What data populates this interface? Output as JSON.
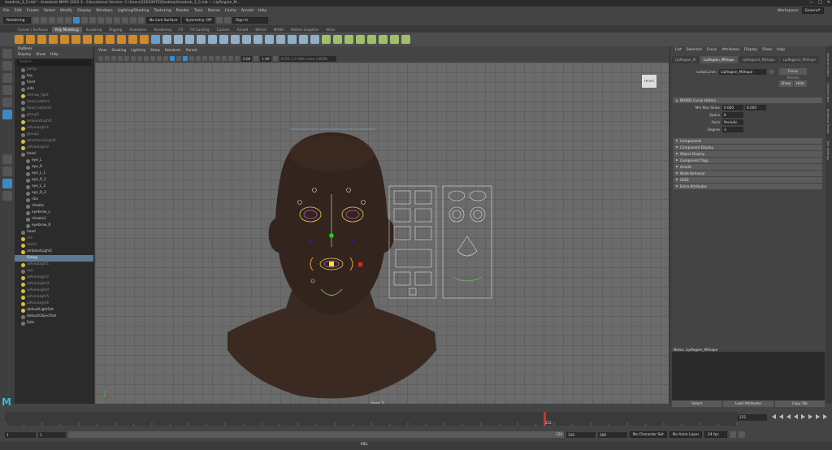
{
  "window": {
    "title": "headrek_3_5.mb* - Autodesk MAYA 2022.3 - Educational Version: C:\\Users\\2201997E\\Desktop\\headrek_3_5.mb  ---  LipRegion_M..."
  },
  "menubar": [
    "File",
    "Edit",
    "Create",
    "Select",
    "Modify",
    "Display",
    "Windows",
    "Lighting/Shading",
    "Texturing",
    "Render",
    "Toon",
    "Stereo",
    "Cache",
    "Arnold",
    "Help"
  ],
  "workspace": {
    "label": "Workspace:",
    "value": "General*"
  },
  "statusline": {
    "mode": "Rendering",
    "live_surface": "No Live Surface",
    "symmetry": "Symmetry: Off",
    "sign_in": "Sign In"
  },
  "shelf_tabs": [
    "Curves / Surfaces",
    "Poly Modeling",
    "Sculpting",
    "Rigging",
    "Animation",
    "Rendering",
    "FX",
    "FX Caching",
    "Custom",
    "Arnold",
    "Bifrost",
    "MASH",
    "Motion Graphics",
    "XGen"
  ],
  "shelf_active": "Poly Modeling",
  "outliner": {
    "title": "Outliner",
    "menu": [
      "Display",
      "Show",
      "Help"
    ],
    "search_placeholder": "Search...",
    "rows": [
      {
        "label": "persp",
        "state": "dim"
      },
      {
        "label": "top",
        "state": ""
      },
      {
        "label": "front",
        "state": ""
      },
      {
        "label": "side",
        "state": ""
      },
      {
        "label": "arlmap_light",
        "state": "dim"
      },
      {
        "label": "head_bottom",
        "state": "dim"
      },
      {
        "label": "head_bottom1",
        "state": "dim"
      },
      {
        "label": "group1",
        "state": "dim"
      },
      {
        "label": "ambientLight1",
        "state": "dim"
      },
      {
        "label": "aiAreaLight1",
        "state": "dim"
      },
      {
        "label": "group2",
        "state": "dim"
      },
      {
        "label": "directionalLight1",
        "state": "dim"
      },
      {
        "label": "aiAreaLight2",
        "state": "dim"
      },
      {
        "label": "head",
        "state": ""
      },
      {
        "label": "eye_L",
        "state": ""
      },
      {
        "label": "eye_R",
        "state": ""
      },
      {
        "label": "eye_L_1",
        "state": ""
      },
      {
        "label": "eye_R_1",
        "state": ""
      },
      {
        "label": "eye_L_2",
        "state": ""
      },
      {
        "label": "eye_R_2",
        "state": ""
      },
      {
        "label": "ribs",
        "state": ""
      },
      {
        "label": "cheeks",
        "state": ""
      },
      {
        "label": "eyebrow_L",
        "state": ""
      },
      {
        "label": "cheeks1",
        "state": ""
      },
      {
        "label": "eyebrow_R",
        "state": ""
      },
      {
        "label": "head",
        "state": ""
      },
      {
        "label": "rim",
        "state": "dim"
      },
      {
        "label": "area1",
        "state": "dim"
      },
      {
        "label": "ambientLight1",
        "state": ""
      },
      {
        "label": "Group",
        "state": "sel"
      },
      {
        "label": "aiAreaLight1",
        "state": "dim"
      },
      {
        "label": "eye",
        "state": "dim"
      },
      {
        "label": "aiAreaLight2",
        "state": "dim"
      },
      {
        "label": "aiAreaLight3",
        "state": "dim"
      },
      {
        "label": "aiAreaLight4",
        "state": "dim"
      },
      {
        "label": "aiAreaLight5",
        "state": "dim"
      },
      {
        "label": "aiAreaLight6",
        "state": "dim"
      },
      {
        "label": "defaultLightSet",
        "state": ""
      },
      {
        "label": "defaultObjectSet",
        "state": ""
      },
      {
        "label": "Eats",
        "state": ""
      }
    ]
  },
  "viewport": {
    "menu": [
      "View",
      "Shading",
      "Lighting",
      "Show",
      "Renderer",
      "Panels"
    ],
    "value_a": "0.00",
    "value_b": "1.00",
    "color_space": "ACES 1.0 SDR-video (sRGB)",
    "camera_button": "FRONT",
    "camera_label": "front_2"
  },
  "attribute_editor": {
    "menu": [
      "List",
      "Selected",
      "Focus",
      "Attributes",
      "Display",
      "Show",
      "Help"
    ],
    "tabs": [
      "LipRegion_M",
      "LipRegion_MShape",
      "LipRegion1_MShape",
      "LipRegion2_MShape"
    ],
    "active_tab": "LipRegion_MShape",
    "node_label": "nurbsCurve:",
    "node_value": "LipRegion_MShape",
    "focus": "Focus",
    "presets": "Presets",
    "show": "Show",
    "hide": "Hide",
    "section_open": "NURBS Curve History",
    "fields": [
      {
        "label": "Min Max Value",
        "values": [
          "0.000",
          "8.000"
        ]
      },
      {
        "label": "Spans",
        "values": [
          "8"
        ]
      },
      {
        "label": "Form",
        "values": [
          "Periodic"
        ]
      },
      {
        "label": "Degree",
        "values": [
          "3"
        ]
      }
    ],
    "sections": [
      "Components",
      "Component Display",
      "Object Display",
      "Component Tags",
      "Arnold",
      "Node Behavior",
      "UUID",
      "Extra Attributes"
    ],
    "notes_label": "Notes:  LipRegion_MShape",
    "buttons": [
      "Select",
      "Load Attributes",
      "Copy Tab"
    ]
  },
  "right_tabs": [
    "Attribute Editor",
    "Channel Box",
    "Modeling Toolkit",
    "Tool Settings"
  ],
  "timeslider": {
    "current": "222",
    "end_frame": "222"
  },
  "range": {
    "start": "1",
    "start2": "1",
    "mid": "120",
    "end_a": "120",
    "end_b": "200",
    "character": "No Character Set",
    "anim_layer": "No Anim Layer",
    "fps": "24 fps"
  },
  "command": {
    "lang": "MEL"
  }
}
